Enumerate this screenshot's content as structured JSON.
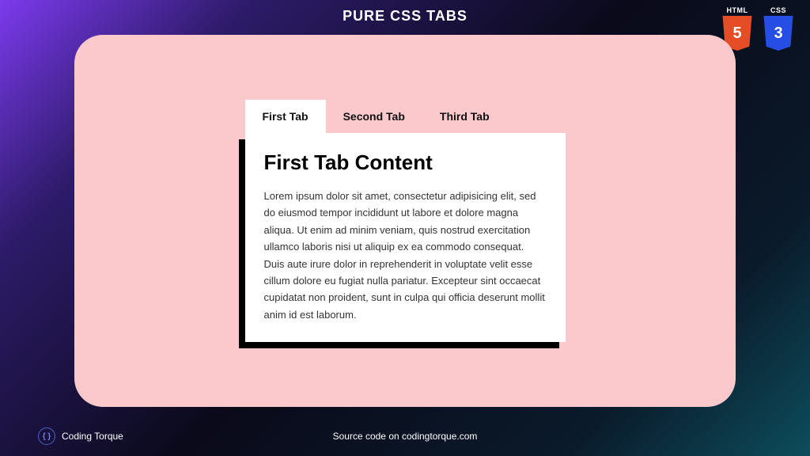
{
  "header": {
    "title": "PURE CSS TABS"
  },
  "badges": {
    "html_label": "HTML",
    "html_glyph": "5",
    "css_label": "CSS",
    "css_glyph": "3"
  },
  "tabs": [
    {
      "label": "First Tab",
      "active": true
    },
    {
      "label": "Second Tab",
      "active": false
    },
    {
      "label": "Third Tab",
      "active": false
    }
  ],
  "content": {
    "heading": "First Tab Content",
    "body": "Lorem ipsum dolor sit amet, consectetur adipisicing elit, sed do eiusmod tempor incididunt ut labore et dolore magna aliqua. Ut enim ad minim veniam, quis nostrud exercitation ullamco laboris nisi ut aliquip ex ea commodo consequat. Duis aute irure dolor in reprehenderit in voluptate velit esse cillum dolore eu fugiat nulla pariatur. Excepteur sint occaecat cupidatat non proident, sunt in culpa qui officia deserunt mollit anim id est laborum."
  },
  "footer": {
    "brand": "Coding Torque",
    "logo_glyph": "{ }",
    "source": "Source code on codingtorque.com"
  }
}
